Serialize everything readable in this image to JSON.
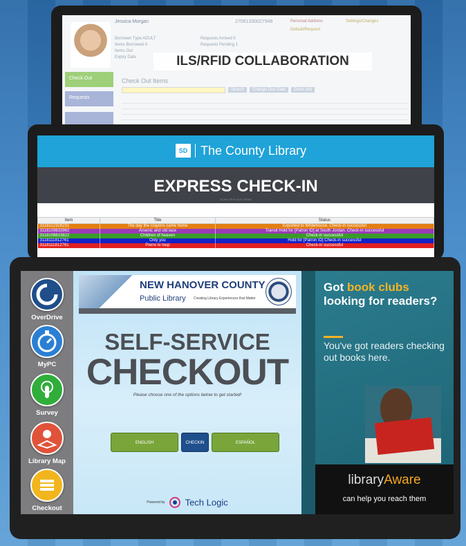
{
  "ils_screen": {
    "patron_name": "Jessica Morgan",
    "patron_id": "27061330027948",
    "flags": [
      "Personal Address",
      "Settings/Changes",
      "Default/Request"
    ],
    "meta_left": [
      "Borrower Type    ADULT",
      "Items Borrowed    4",
      "Items Out",
      "Expiry Date"
    ],
    "meta_right": [
      "Requests Arrived    0",
      "Requests Pending    1"
    ],
    "nav_checkout": "Check Out",
    "nav_requests": "Requests",
    "section_title": "Check Out Items",
    "actions": [
      "Search",
      "Change Due Date",
      "Done (x4)"
    ],
    "overlay_label": "ILS/RFID COLLABORATION"
  },
  "checkin_screen": {
    "logo_text": "SD",
    "library_name": "The County Library",
    "title": "EXPRESS CHECK-IN",
    "hint": "SCAN OR PLACE ITEMS",
    "columns": [
      "Item",
      "Title",
      "Status"
    ],
    "rows": [
      {
        "item": "3118112316231",
        "title": "The day the crayons came home",
        "status": "Exported to Whitehouse. Check-in successful",
        "color": "#e37f12"
      },
      {
        "item": "3118109833962",
        "title": "Arsenic and old lace",
        "status": "Transit Hold for    [Patron ID]    at South Jordan. Check-in successful",
        "color": "#9b3ab6"
      },
      {
        "item": "3118108815822",
        "title": "Children of heaven",
        "status": "Check-in successful",
        "color": "#3a9b28"
      },
      {
        "item": "3118111812761",
        "title": "Only you",
        "status": "Hold for    [Patron ID]    Check-in successful",
        "color": "#1420c8"
      },
      {
        "item": "3118111812761",
        "title": "Pierre le loup",
        "status": "Check-in successful",
        "color": "#e02020"
      }
    ]
  },
  "kiosk": {
    "sidebar": [
      {
        "label": "OverDrive",
        "icon": "overdrive-icon",
        "color": "#1f4e8a"
      },
      {
        "label": "MyPC",
        "icon": "stopwatch-icon",
        "color": "#2a7fd4"
      },
      {
        "label": "Survey",
        "icon": "touch-icon",
        "color": "#2fae3a"
      },
      {
        "label": "Library Map",
        "icon": "map-pin-icon",
        "color": "#e0533a"
      },
      {
        "label": "Checkout",
        "icon": "book-stack-icon",
        "color": "#f2b51d"
      }
    ],
    "banner_line1": "NEW HANOVER COUNTY",
    "banner_line2": "Public Library",
    "banner_tagline": "Creating Library Experiences that Matter",
    "title_line1": "SELF-SERVICE",
    "title_line2": "CHECKOUT",
    "instruction": "Please choose one of the options below to get started!",
    "buttons": {
      "english": "ENGLISH",
      "checkin": "CHECKIN",
      "espanol": "ESPAÑOL"
    },
    "powered_by": "Powered by",
    "brand": "Tech Logic",
    "colors": {
      "english": "#79a53a",
      "checkin": "#1f4f8c",
      "espanol": "#79a53a"
    }
  },
  "ad": {
    "headline_pre": "Got ",
    "headline_highlight": "book clubs",
    "headline_post": " looking for readers?",
    "body": "You've got readers checking out books here.",
    "brand_a": "library",
    "brand_b": "Aware",
    "tagline": "can help you reach them"
  }
}
